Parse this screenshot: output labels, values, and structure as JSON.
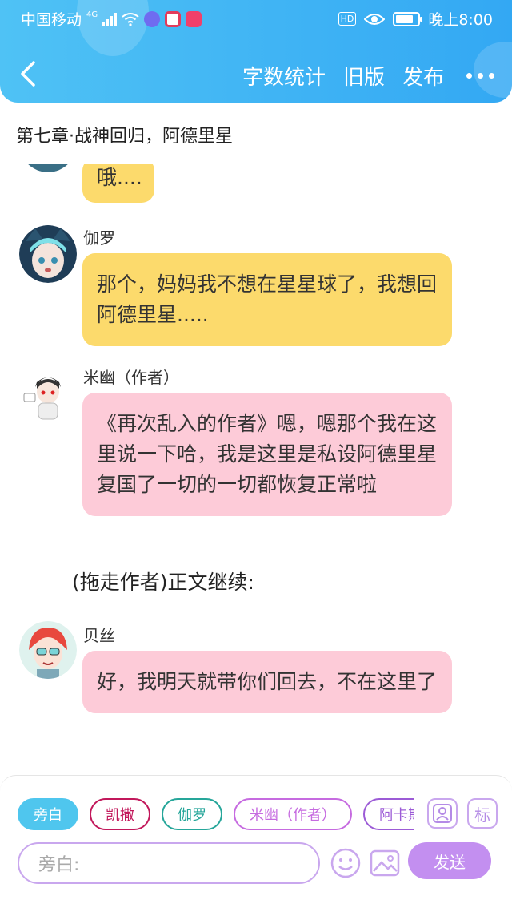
{
  "status_bar": {
    "carrier": "中国移动",
    "network": "4G",
    "hd_badge": "HD",
    "time": "晚上8:00",
    "battery_level": 0.8
  },
  "nav": {
    "back_icon": "chevron-left-icon",
    "word_count": "字数统计",
    "old_version": "旧版",
    "publish": "发布",
    "more_icon": "more-dots-icon"
  },
  "chapter_title": "第七章·战神回归，阿德里星",
  "messages": [
    {
      "speaker": "",
      "text": "哦....",
      "color": "#fcda6c"
    },
    {
      "speaker": "伽罗",
      "text": "那个，妈妈我不想在星星球了，我想回阿德里星.....",
      "color": "#fcda6c"
    },
    {
      "speaker": "米幽（作者）",
      "text": "《再次乱入的作者》嗯，嗯那个我在这里说一下哈，我是这里是私设阿德里星复国了一切的一切都恢复正常啦",
      "color": "#fdcbd8"
    },
    {
      "speaker": "贝丝",
      "text": "好，我明天就带你们回去，不在这里了",
      "color": "#fdcbd8"
    }
  ],
  "narration": "(拖走作者)正文继续:",
  "composer": {
    "roles": [
      {
        "label": "旁白",
        "color": "#4fc6ee",
        "selected": true
      },
      {
        "label": "凯撒",
        "color": "#c2185b",
        "selected": false
      },
      {
        "label": "伽罗",
        "color": "#26a69a",
        "selected": false
      },
      {
        "label": "米幽（作者）",
        "color": "#c66be0",
        "selected": false
      },
      {
        "label": "阿卡斯",
        "color": "#9c5bd6",
        "selected": false
      }
    ],
    "role_manage_icon": "person-card-icon",
    "tag_label": "标",
    "input_placeholder": "旁白:",
    "emoji_icon": "smiley-icon",
    "image_icon": "image-icon",
    "send_label": "发送"
  }
}
